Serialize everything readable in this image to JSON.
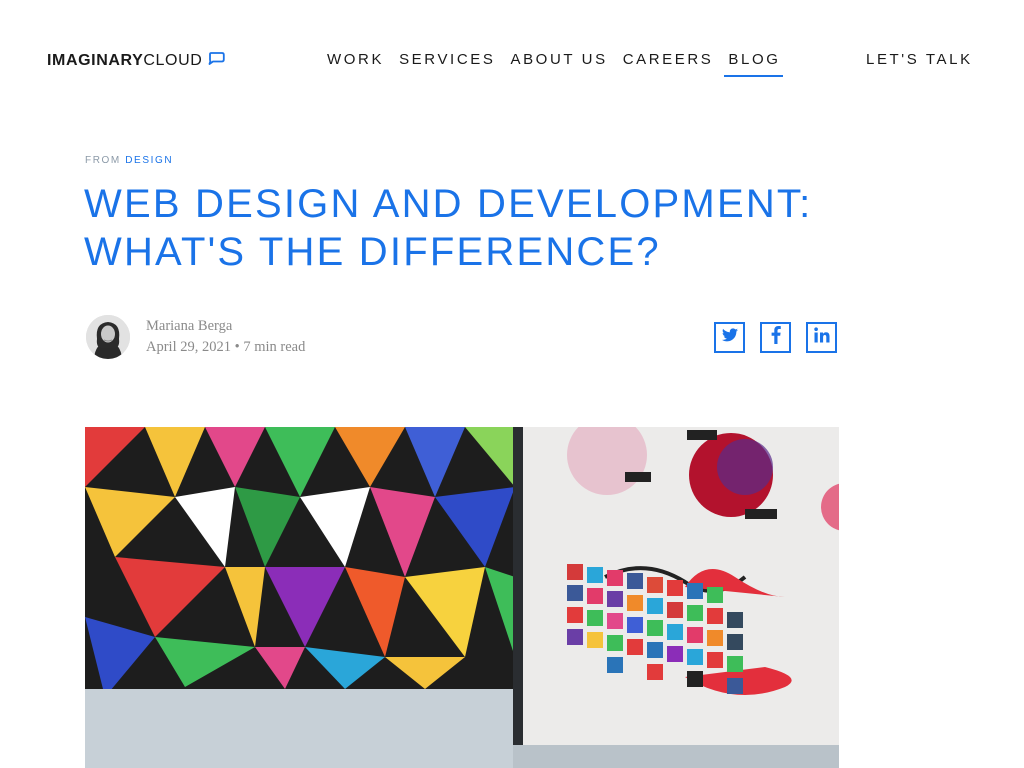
{
  "header": {
    "logo": {
      "bold": "IMAGINARY",
      "light": "CLOUD",
      "icon": "chat-bubble-icon"
    },
    "nav": [
      {
        "label": "WORK",
        "active": false
      },
      {
        "label": "SERVICES",
        "active": false
      },
      {
        "label": "ABOUT US",
        "active": false
      },
      {
        "label": "CAREERS",
        "active": false
      },
      {
        "label": "BLOG",
        "active": true
      }
    ],
    "cta": "LET'S TALK"
  },
  "article": {
    "breadcrumb": {
      "prefix": "FROM",
      "category": "DESIGN"
    },
    "title_line1": "WEB DESIGN AND DEVELOPMENT:",
    "title_line2": "WHAT'S THE DIFFERENCE?",
    "author": {
      "name": "Mariana Berga",
      "date": "April 29, 2021",
      "separator": "•",
      "read_time": "7 min read"
    },
    "share": [
      {
        "icon": "twitter-icon"
      },
      {
        "icon": "facebook-icon"
      },
      {
        "icon": "linkedin-icon"
      }
    ],
    "hero_image": "laptop-with-colorful-social-icons-and-geometric-art"
  },
  "colors": {
    "accent": "#1a73e8",
    "text": "#1a1a1a",
    "muted": "#8a8a8a"
  }
}
